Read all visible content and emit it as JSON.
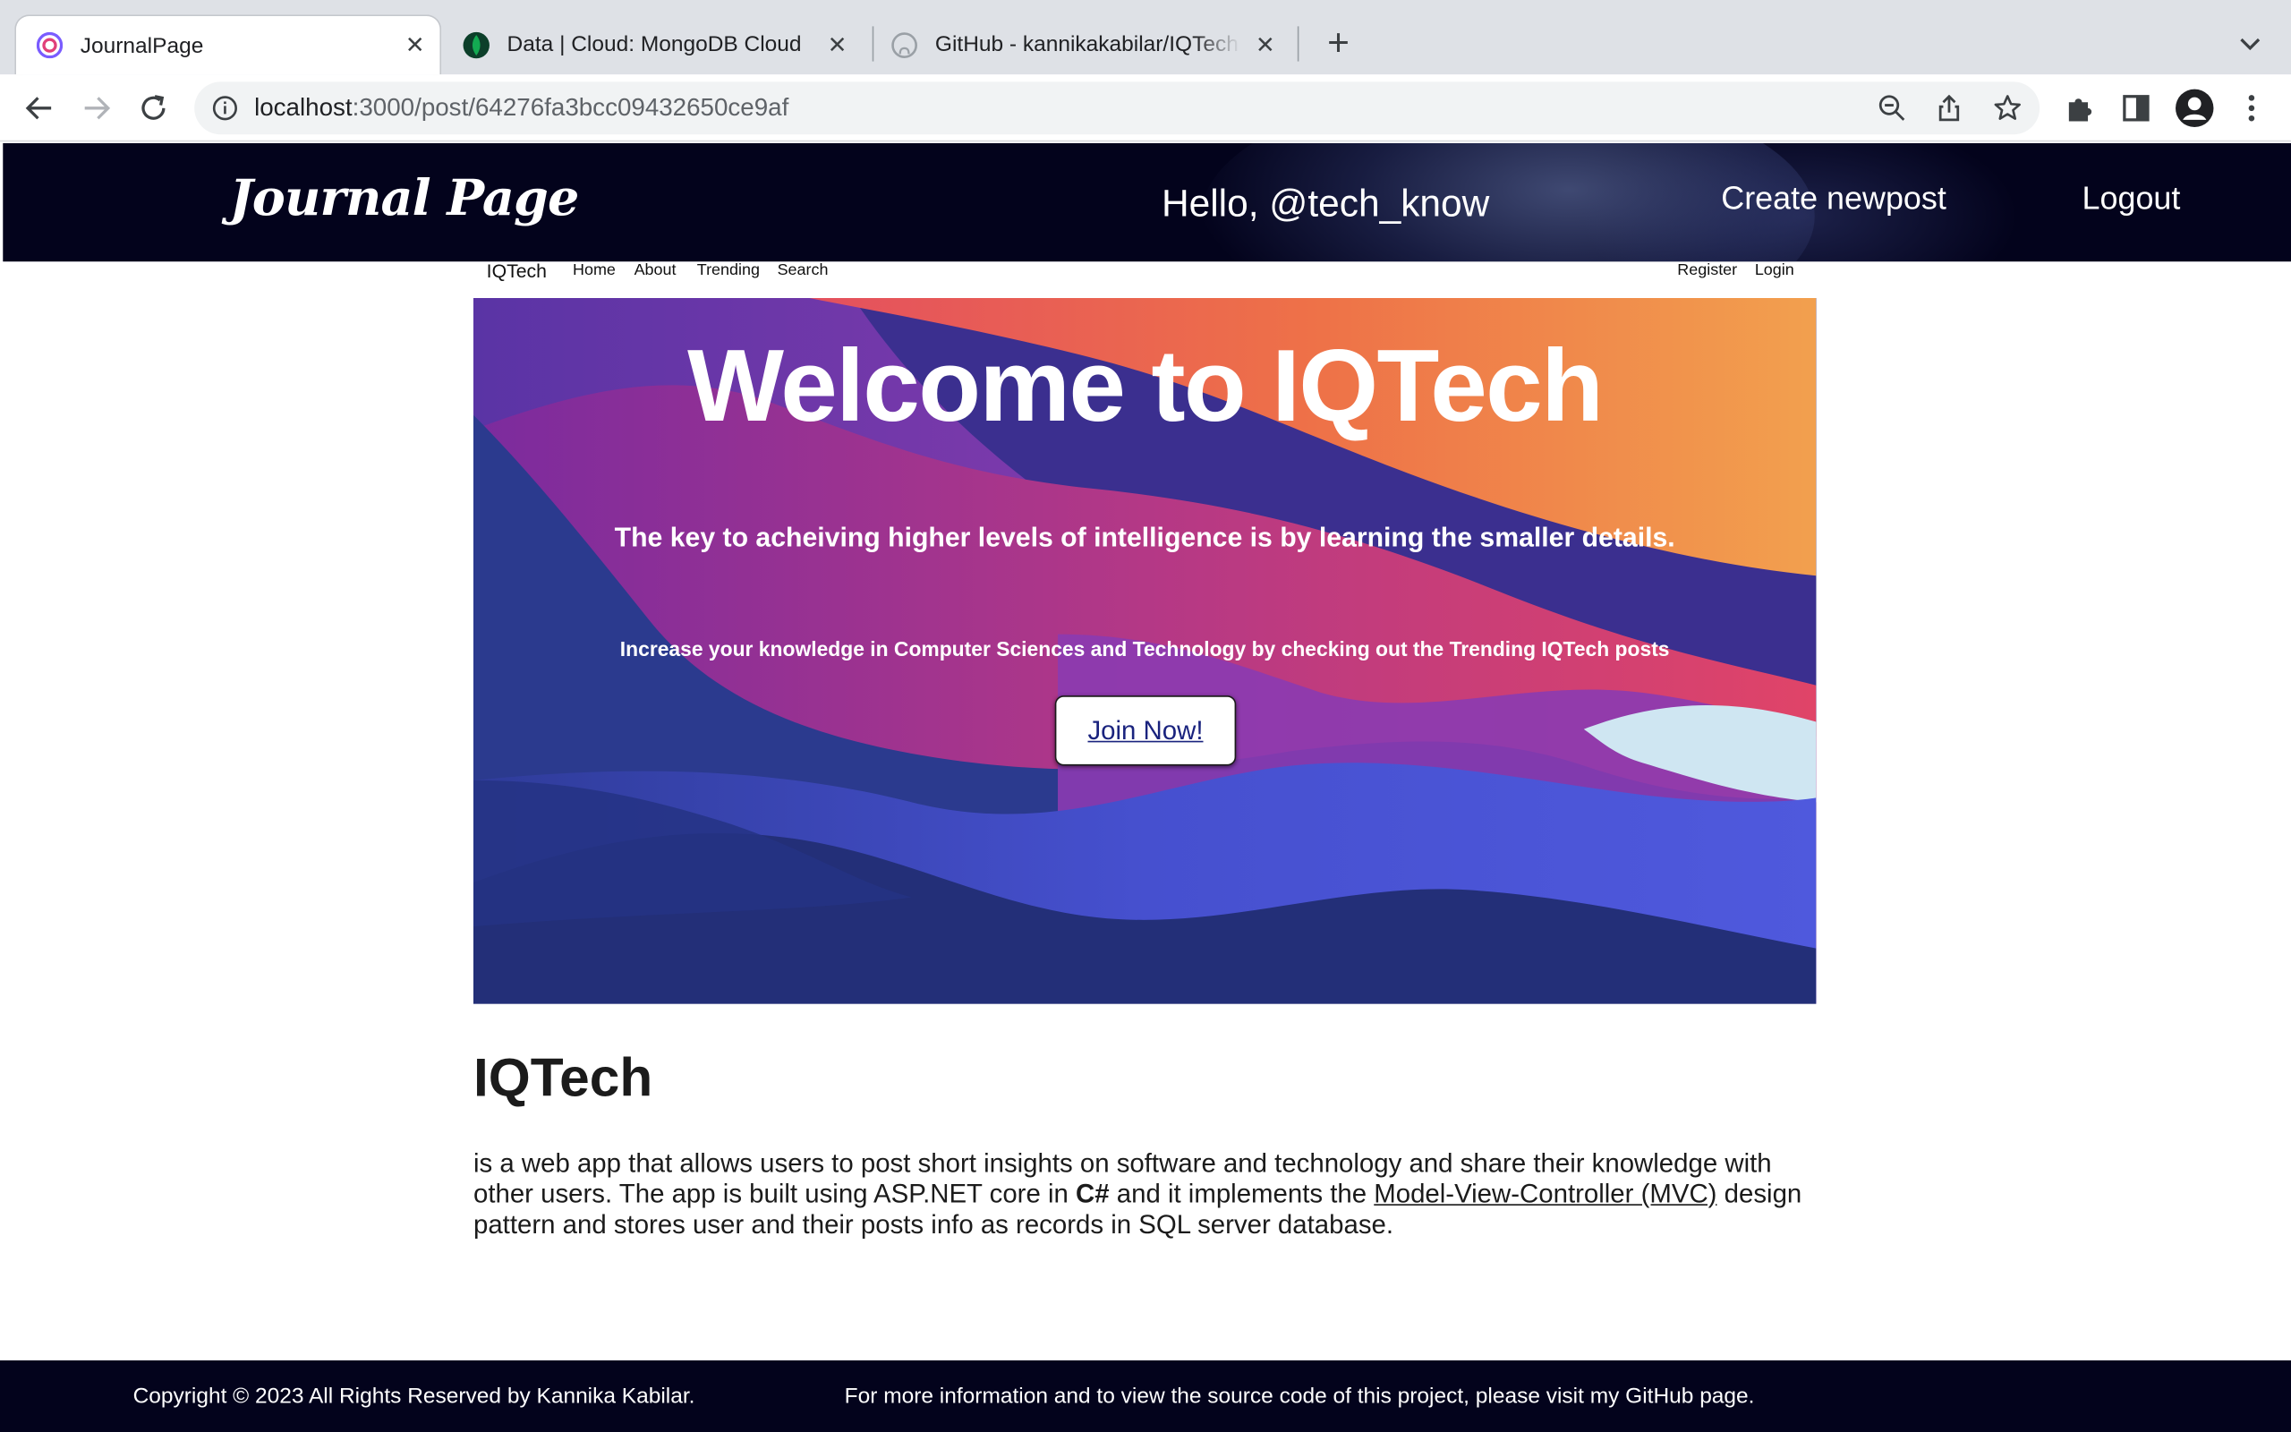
{
  "browser": {
    "tabs": [
      {
        "title": "JournalPage",
        "active": true,
        "icon": "journalpage-favicon"
      },
      {
        "title": "Data | Cloud: MongoDB Cloud",
        "active": false,
        "icon": "mongodb-leaf-icon"
      },
      {
        "title": "GitHub - kannikakabilar/IQTech",
        "active": false,
        "icon": "github-icon"
      }
    ],
    "address": {
      "host": "localhost",
      "path": ":3000/post/64276fa3bcc09432650ce9af"
    }
  },
  "journal": {
    "logo": "Journal Page",
    "greeting": "Hello, @tech_know",
    "nav": {
      "create": "Create newpost",
      "logout": "Logout"
    }
  },
  "iqtech": {
    "nav": {
      "brand": "IQTech",
      "links": [
        "Home",
        "About",
        "Trending",
        "Search"
      ],
      "register": "Register",
      "login": "Login"
    },
    "hero": {
      "title": "Welcome to IQTech",
      "subtitle": "The key to acheiving higher levels of intelligence is by learning the smaller details.",
      "tagline": "Increase your knowledge in Computer Sciences and Technology by checking out the Trending IQTech posts",
      "button": "Join Now!"
    }
  },
  "post": {
    "heading": "IQTech",
    "p_part1": "is a web app that allows users to post short insights on software and technology and share their knowledge with other users. The app is built using ASP.NET core in ",
    "p_bold": "C#",
    "p_part2": " and it implements the ",
    "p_link": "Model-View-Controller (MVC)",
    "p_part3": " design pattern and stores user and their posts info as records in SQL server database."
  },
  "footer": {
    "copyright": "Copyright © 2023 All Rights Reserved by Kannika Kabilar.",
    "info": "For more information and to view the source code of this project, please visit my GitHub page."
  },
  "colors": {
    "header_bg": "#03031c",
    "tabstrip_bg": "#dee1e6",
    "hero_purple": "#6a2fa0",
    "hero_orange": "#ee7d4a",
    "hero_blue": "#4e58dc"
  }
}
